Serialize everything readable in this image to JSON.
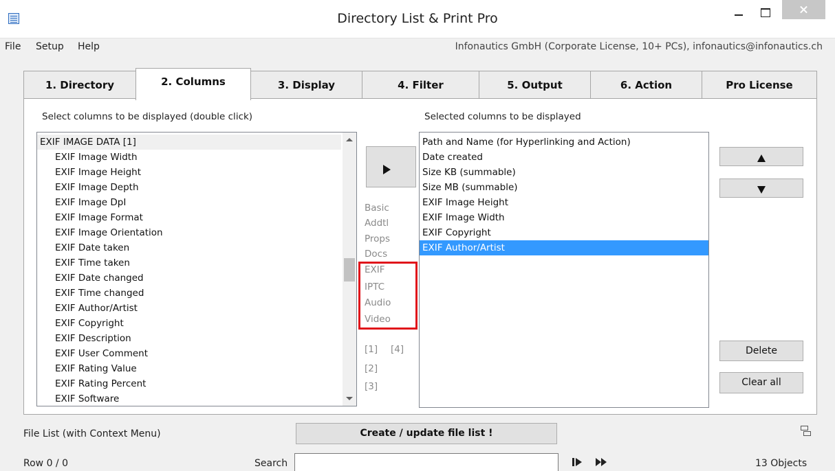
{
  "window": {
    "title": "Directory List & Print Pro"
  },
  "menu": {
    "items": [
      "File",
      "Setup",
      "Help"
    ],
    "license": "Infonautics GmbH (Corporate License, 10+ PCs), infonautics@infonautics.ch"
  },
  "tabs": [
    "1. Directory",
    "2. Columns",
    "3. Display",
    "4. Filter",
    "5. Output",
    "6. Action",
    "Pro License"
  ],
  "active_tab": "2. Columns",
  "available": {
    "label": "Select columns to be displayed (double click)",
    "items": [
      "EXIF IMAGE DATA [1]",
      "EXIF Image Width",
      "EXIF Image Height",
      "EXIF Image Depth",
      "EXIF Image DpI",
      "EXIF Image Format",
      "EXIF Image Orientation",
      "EXIF Date taken",
      "EXIF Time taken",
      "EXIF Date changed",
      "EXIF Time changed",
      "EXIF Author/Artist",
      "EXIF Copyright",
      "EXIF Description",
      "EXIF User Comment",
      "EXIF Rating Value",
      "EXIF Rating Percent",
      "EXIF Software"
    ]
  },
  "selected": {
    "label": "Selected columns to be displayed",
    "items": [
      "Path and Name  (for Hyperlinking and Action)",
      "Date created",
      "Size KB  (summable)",
      "Size MB  (summable)",
      "EXIF Image Height",
      "EXIF Image Width",
      "EXIF Copyright",
      "EXIF Author/Artist"
    ],
    "selected_item": "EXIF Author/Artist"
  },
  "categories": [
    "Basic",
    "Addtl",
    "Props",
    "Docs",
    "EXIF",
    "IPTC",
    "Audio",
    "Video"
  ],
  "pages": [
    "[1]",
    "[4]",
    "[2]",
    "[3]"
  ],
  "buttons": {
    "delete": "Delete",
    "clear_all": "Clear all"
  },
  "bottom": {
    "file_list_label": "File List (with Context Menu)",
    "create_button": "Create / update file list !",
    "row_label": "Row 0 / 0",
    "search_label": "Search",
    "search_value": "",
    "objects": "13 Objects"
  },
  "colors": {
    "highlight": "#e0131a",
    "selection": "#3399ff"
  }
}
